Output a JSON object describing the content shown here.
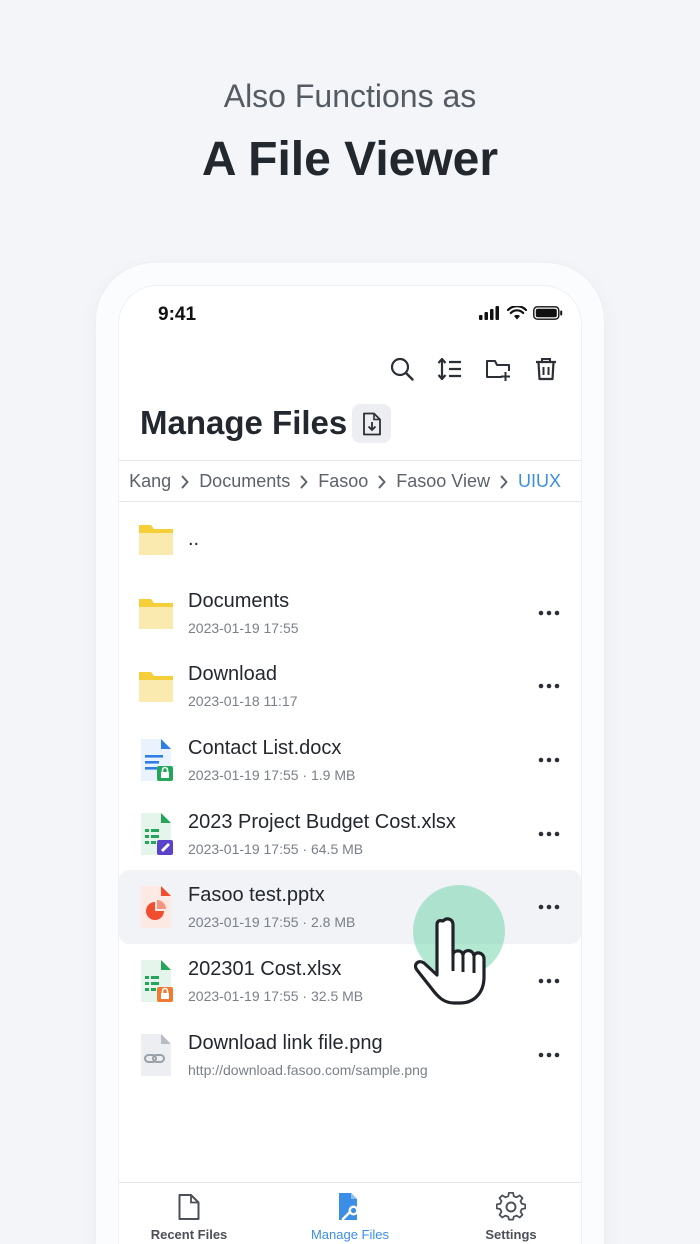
{
  "headline": {
    "sub": "Also Functions as",
    "main": "A File Viewer"
  },
  "status_bar": {
    "time": "9:41"
  },
  "toolbar": {
    "search": "search-icon",
    "sort": "sort-icon",
    "new_folder": "folder-add-icon",
    "delete": "trash-icon"
  },
  "page": {
    "title": "Manage Files"
  },
  "breadcrumb": {
    "items": [
      "Kang",
      "Documents",
      "Fasoo",
      "Fasoo View",
      "UIUX"
    ]
  },
  "files": [
    {
      "name": "..",
      "meta": "",
      "type": "folder"
    },
    {
      "name": "Documents",
      "meta": "2023-01-19  17:55",
      "type": "folder"
    },
    {
      "name": "Download",
      "meta": "2023-01-18  11:17",
      "type": "folder"
    },
    {
      "name": "Contact List.docx",
      "meta": "2023-01-19  17:55 · 1.9 MB",
      "type": "docx"
    },
    {
      "name": "2023 Project Budget Cost.xlsx",
      "meta": "2023-01-19  17:55 · 64.5 MB",
      "type": "xlsx-purple"
    },
    {
      "name": "Fasoo test.pptx",
      "meta": "2023-01-19  17:55 · 2.8 MB",
      "type": "pptx"
    },
    {
      "name": "202301 Cost.xlsx",
      "meta": "2023-01-19  17:55 · 32.5 MB",
      "type": "xlsx-orange"
    },
    {
      "name": "Download link file.png",
      "meta": "http://download.fasoo.com/sample.png",
      "type": "link"
    }
  ],
  "tabs": [
    {
      "label": "Recent Files",
      "icon": "file-icon"
    },
    {
      "label": "Manage Files",
      "icon": "manage-files-icon"
    },
    {
      "label": "Settings",
      "icon": "gear-icon"
    }
  ],
  "colors": {
    "accent": "#3a8ee6",
    "folder": "#f5cf3a",
    "docx": "#2f7ee8",
    "xlsx": "#23a65a",
    "pptx": "#f04e2f",
    "tap": "#74d6ad"
  }
}
